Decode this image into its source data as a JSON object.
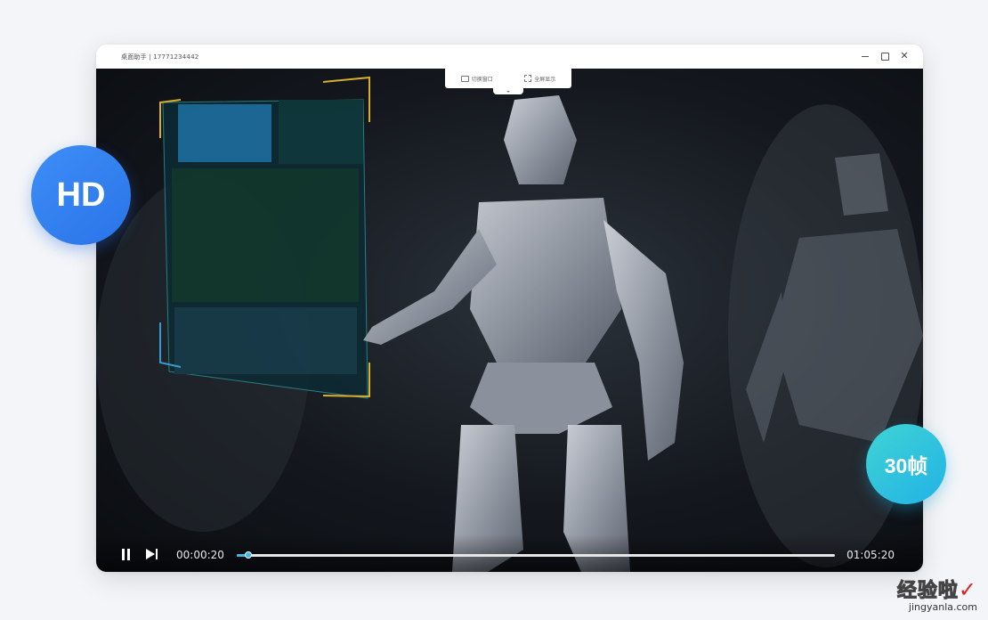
{
  "window": {
    "title": "桌面助手 | 17771234442",
    "minimize_icon": "minimize-icon",
    "maximize_icon": "maximize-icon",
    "close_glyph": "✕"
  },
  "toolbar": {
    "items": [
      {
        "label": "切换窗口",
        "icon": "window-icon"
      },
      {
        "label": "全屏显示",
        "icon": "fullscreen-icon"
      }
    ]
  },
  "player": {
    "current_time": "00:00:20",
    "total_time": "01:05:20",
    "progress": 0.02,
    "accent": "#3fb7e8"
  },
  "badges": {
    "hd": "HD",
    "fps": "30帧",
    "hd_color": "#3d8ef7",
    "fps_color": "#2fc3df"
  },
  "watermark": {
    "text": "经验啦",
    "check": "✓",
    "url": "jingyanla.com"
  }
}
